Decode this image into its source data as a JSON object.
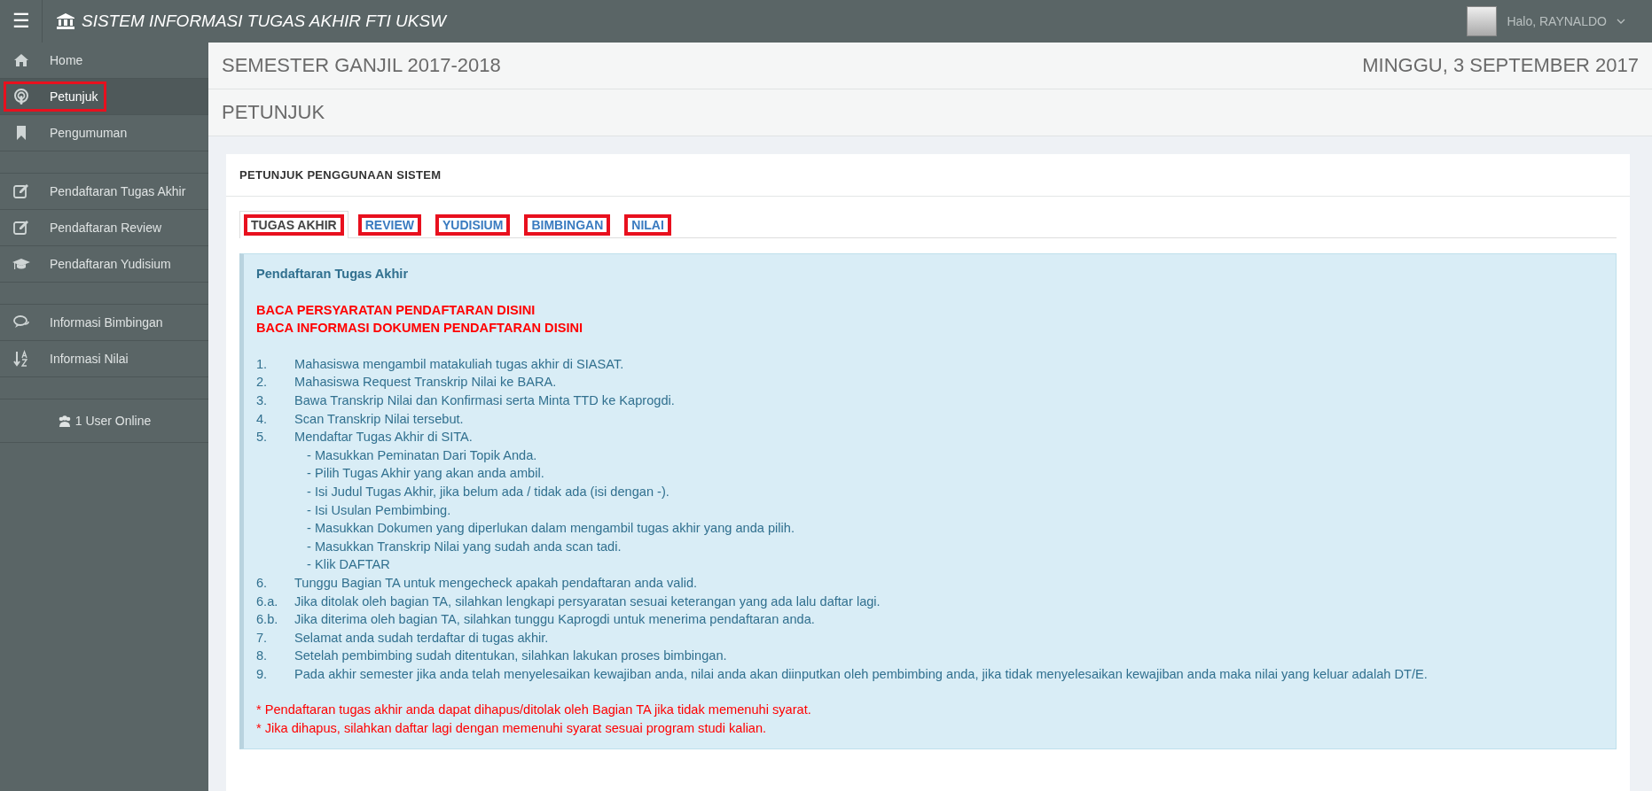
{
  "topbar": {
    "menu_icon": "☰",
    "title": "SISTEM INFORMASI TUGAS AKHIR FTI UKSW",
    "user": "Halo, RAYNALDO"
  },
  "sidebar": {
    "groups": [
      {
        "items": [
          {
            "label": "Home",
            "selected": false,
            "highlighted": false
          },
          {
            "label": "Petunjuk",
            "selected": true,
            "highlighted": true
          },
          {
            "label": "Pengumuman",
            "selected": false,
            "highlighted": false
          }
        ]
      },
      {
        "items": [
          {
            "label": "Pendaftaran Tugas Akhir",
            "selected": false,
            "highlighted": false
          },
          {
            "label": "Pendaftaran Review",
            "selected": false,
            "highlighted": false
          },
          {
            "label": "Pendaftaran Yudisium",
            "selected": false,
            "highlighted": false
          }
        ]
      },
      {
        "items": [
          {
            "label": "Informasi Bimbingan",
            "selected": false,
            "highlighted": false
          },
          {
            "label": "Informasi Nilai",
            "selected": false,
            "highlighted": false
          }
        ]
      }
    ],
    "online": "1 User Online"
  },
  "header": {
    "semester": "SEMESTER GANJIL 2017-2018",
    "date": "MINGGU, 3 SEPTEMBER 2017",
    "page_title": "PETUNJUK"
  },
  "card": {
    "title": "PETUNJUK PENGGUNAAN SISTEM",
    "tabs": [
      {
        "label": "TUGAS AKHIR",
        "selected": true,
        "highlighted": true
      },
      {
        "label": "REVIEW",
        "selected": false,
        "highlighted": true
      },
      {
        "label": "YUDISIUM",
        "selected": false,
        "highlighted": true
      },
      {
        "label": "BIMBINGAN",
        "selected": false,
        "highlighted": true
      },
      {
        "label": "NILAI",
        "selected": false,
        "highlighted": true
      }
    ],
    "panel": {
      "heading": "Pendaftaran Tugas Akhir",
      "links": [
        "BACA PERSYARATAN PENDAFTARAN DISINI",
        "BACA INFORMASI DOKUMEN PENDAFTARAN DISINI"
      ],
      "steps": [
        {
          "number": "1.",
          "text": "Mahasiswa mengambil matakuliah tugas akhir di SIASAT."
        },
        {
          "number": "2.",
          "text": "Mahasiswa Request Transkrip Nilai ke BARA."
        },
        {
          "number": "3.",
          "text": "Bawa Transkrip Nilai dan Konfirmasi serta Minta TTD ke Kaprogdi."
        },
        {
          "number": "4.",
          "text": "Scan Transkrip Nilai tersebut."
        },
        {
          "number": "5.",
          "text": "Mendaftar Tugas Akhir di SITA.",
          "children": [
            {
              "text": "- Masukkan Peminatan Dari Topik Anda."
            },
            {
              "text": "- Pilih Tugas Akhir yang akan anda ambil."
            },
            {
              "text": "- Isi Judul Tugas Akhir, jika belum ada / tidak ada (isi dengan -)."
            },
            {
              "text": "- Isi Usulan Pembimbing."
            },
            {
              "text": "- Masukkan Dokumen yang diperlukan dalam mengambil tugas akhir yang anda pilih."
            },
            {
              "text": "- Masukkan Transkrip Nilai yang sudah anda scan tadi."
            },
            {
              "text": "- Klik DAFTAR"
            }
          ]
        },
        {
          "number": "6.",
          "text": "Tunggu Bagian TA untuk mengecheck apakah pendaftaran anda valid."
        },
        {
          "number": "6.a.",
          "text": "Jika ditolak oleh bagian TA, silahkan lengkapi persyaratan sesuai keterangan yang ada lalu daftar lagi."
        },
        {
          "number": "6.b.",
          "text": "Jika diterima oleh bagian TA, silahkan tunggu Kaprogdi untuk menerima pendaftaran anda."
        },
        {
          "number": "7.",
          "text": "Selamat anda sudah terdaftar di tugas akhir."
        },
        {
          "number": "8.",
          "text": "Setelah pembimbing sudah ditentukan, silahkan lakukan proses bimbingan."
        },
        {
          "number": "9.",
          "text": "Pada akhir semester jika anda telah menyelesaikan kewajiban anda, nilai anda akan diinputkan oleh pembimbing anda, jika tidak menyelesaikan kewajiban anda maka nilai yang keluar adalah DT/E."
        }
      ],
      "notes": [
        "* Pendaftaran tugas akhir anda dapat dihapus/ditolak oleh Bagian TA jika tidak memenuhi syarat.",
        "* Jika dihapus, silahkan daftar lagi dengan memenuhi syarat sesuai program studi kalian."
      ]
    }
  }
}
